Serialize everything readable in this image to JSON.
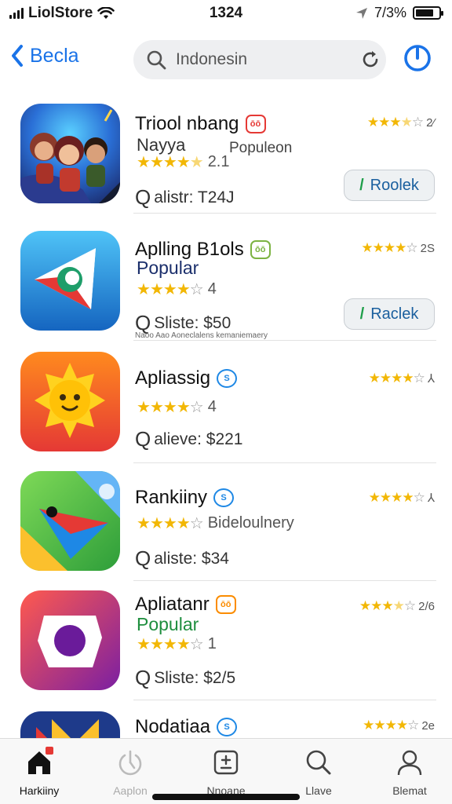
{
  "status": {
    "carrier": "LiolStore",
    "time": "1324",
    "battery_text": "7/3%",
    "battery_level": 0.8
  },
  "nav": {
    "back_label": "Becla",
    "search_value": "Indonesin"
  },
  "apps": [
    {
      "title": "Triool nbang",
      "badge": "ōō",
      "badge_color": "#e53935",
      "subtitle": "Nayya",
      "subtitle_color": "#333333",
      "extra_label": "Populeon",
      "rating_text": "2.1",
      "rating_stars": 4.5,
      "price": "alistr: T24J",
      "corner_rating": "2⁄",
      "corner_stars": 3.5,
      "action_label": "Roolek",
      "fine_print": ""
    },
    {
      "title": "Aplling B1ols",
      "badge": "ōō",
      "badge_color": "#7cb342",
      "subtitle": "Popular",
      "subtitle_color": "#1a2e6b",
      "extra_label": "",
      "rating_text": "4",
      "rating_stars": 4,
      "price": "Sliste: $50",
      "corner_rating": "2S",
      "corner_stars": 4,
      "action_label": "Raclek",
      "fine_print": "Naoo  Aao  Aoneclalens  kemaniemaery"
    },
    {
      "title": "Apliassig",
      "badge": "S",
      "badge_color": "#1e88e5",
      "subtitle": "",
      "subtitle_color": "#333333",
      "extra_label": "",
      "rating_text": "4",
      "rating_stars": 4,
      "price": "alieve: $221",
      "corner_rating": "⅄",
      "corner_stars": 4,
      "action_label": "",
      "fine_print": ""
    },
    {
      "title": "Rankiiny",
      "badge": "S",
      "badge_color": "#1e88e5",
      "subtitle": "",
      "subtitle_color": "#333333",
      "extra_label": "",
      "rating_text": "Bideloulnery",
      "rating_stars": 4,
      "price": "aliste: $34",
      "corner_rating": "⅄",
      "corner_stars": 4,
      "action_label": "",
      "fine_print": ""
    },
    {
      "title": "Apliatanr",
      "badge": "ōō",
      "badge_color": "#fb8c00",
      "subtitle": "Popular",
      "subtitle_color": "#1e8e3e",
      "extra_label": "",
      "rating_text": "1",
      "rating_stars": 4,
      "price": "Sliste: $2/5",
      "corner_rating": "2/6",
      "corner_stars": 3.5,
      "action_label": "",
      "fine_print": ""
    },
    {
      "title": "Nodatiaa",
      "badge": "S",
      "badge_color": "#1e88e5",
      "subtitle": "",
      "subtitle_color": "#333333",
      "extra_label": "",
      "rating_text": "",
      "rating_stars": 0,
      "price": "",
      "corner_rating": "2e",
      "corner_stars": 4,
      "action_label": "",
      "fine_print": ""
    }
  ],
  "tabs": [
    {
      "label": "Harkiiny",
      "icon": "home-icon",
      "active": true,
      "badge": true
    },
    {
      "label": "Aaplon",
      "icon": "power-icon",
      "active": false,
      "badge": false
    },
    {
      "label": "Nnoane",
      "icon": "calculator-icon",
      "active": false,
      "badge": false
    },
    {
      "label": "Llave",
      "icon": "search-icon",
      "active": false,
      "badge": false
    },
    {
      "label": "Blemat",
      "icon": "profile-icon",
      "active": false,
      "badge": false
    }
  ],
  "colors": {
    "accent": "#1a73e8",
    "star": "#f2b705",
    "notification": "#e53935"
  }
}
